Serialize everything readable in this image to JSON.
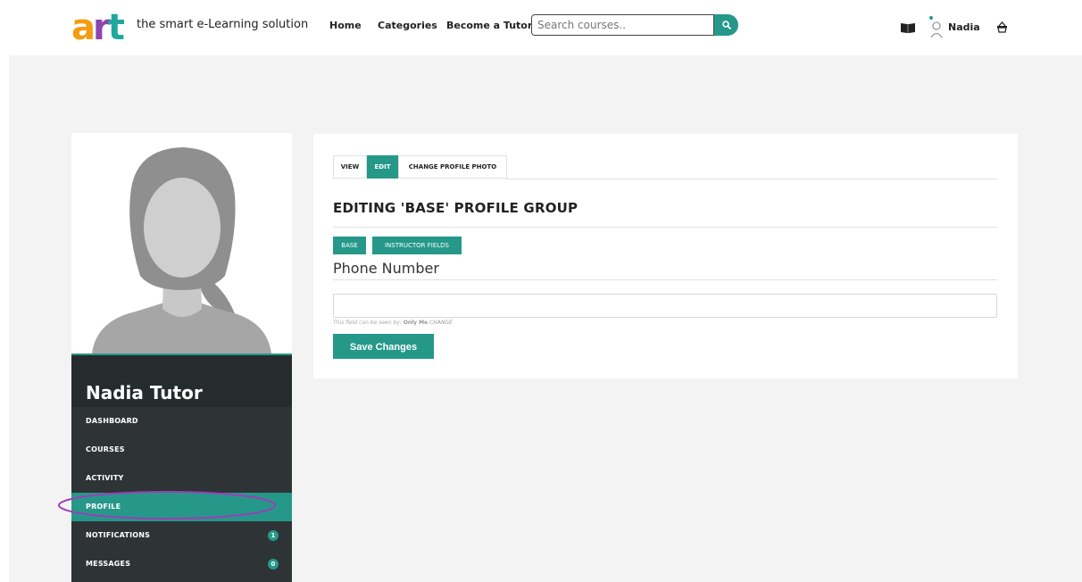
{
  "header": {
    "logo_text": "art",
    "tagline": "the smart e-Learning solution",
    "nav": [
      {
        "label": "Home"
      },
      {
        "label": "Categories"
      },
      {
        "label": "Become a Tutor"
      }
    ],
    "search": {
      "placeholder": "Search courses..",
      "value": ""
    },
    "user_name": "Nadia",
    "icons": [
      "book-icon",
      "user-avatar-icon",
      "basket-icon",
      "search-icon"
    ]
  },
  "profile": {
    "display_name": "Nadia Tutor",
    "menu": [
      {
        "label": "DASHBOARD",
        "active": false
      },
      {
        "label": "COURSES",
        "active": false
      },
      {
        "label": "ACTIVITY",
        "active": false
      },
      {
        "label": "PROFILE",
        "active": true
      },
      {
        "label": "NOTIFICATIONS",
        "active": false,
        "badge": "1"
      },
      {
        "label": "MESSAGES",
        "active": false,
        "badge": "0"
      }
    ]
  },
  "panel": {
    "tabs": [
      {
        "label": "VIEW",
        "active": false
      },
      {
        "label": "EDIT",
        "active": true
      },
      {
        "label": "CHANGE PROFILE PHOTO",
        "active": false
      }
    ],
    "heading": "EDITING 'BASE' PROFILE GROUP",
    "groups": [
      {
        "label": "BASE"
      },
      {
        "label": "INSTRUCTOR FIELDS"
      }
    ],
    "field_label": "Phone Number",
    "field_value": "",
    "privacy": {
      "prefix": "This field can be seen by:",
      "level": "Only Me",
      "change": "CHANGE"
    },
    "save_label": "Save Changes"
  },
  "colors": {
    "accent": "#26988a",
    "logo_orange": "#f39c12",
    "logo_purple": "#8e44ad",
    "logo_teal": "#1fa89b",
    "sidebar_bg": "#2e3436",
    "highlight_ring": "#9b3fb5",
    "page_bg": "#f3f3f3"
  }
}
